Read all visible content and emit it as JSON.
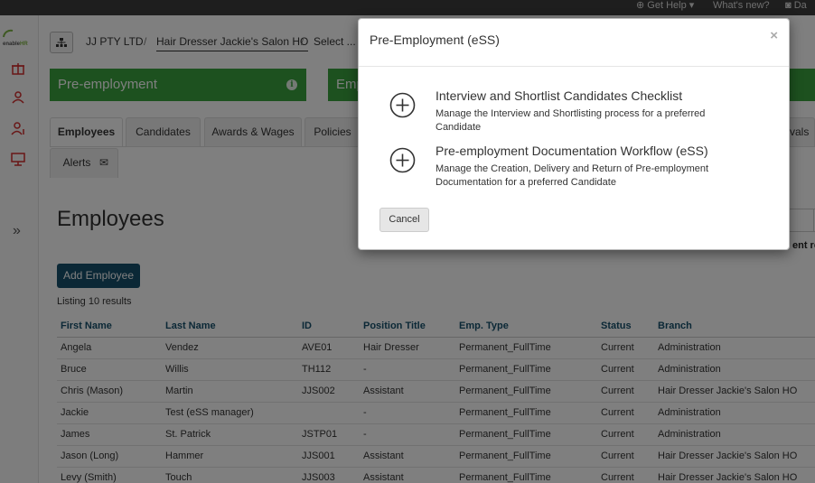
{
  "topbar": {
    "help_label": "Get Help",
    "whats_new_label": "What's new?",
    "account_label": "Da"
  },
  "sidebar": {
    "logo_text_a": "enable",
    "logo_text_b": "HR"
  },
  "breadcrumb": {
    "company": "JJ PTY LTD",
    "location": "Hair Dresser Jackie's Salon HO",
    "select": "Select ..."
  },
  "tiles": [
    {
      "label": "Pre-employment"
    },
    {
      "label": "Emp"
    }
  ],
  "tabs": [
    {
      "label": "Employees"
    },
    {
      "label": "Candidates"
    },
    {
      "label": "Awards & Wages"
    },
    {
      "label": "Policies"
    },
    {
      "label": "vals"
    },
    {
      "label": "Alerts"
    }
  ],
  "page": {
    "title": "Employees",
    "add_button": "Add Employee",
    "listing": "Listing 10 results",
    "right_hint": "ent re",
    "right_dot": "."
  },
  "table": {
    "headers": [
      "First Name",
      "Last Name",
      "ID",
      "Position Title",
      "Emp. Type",
      "Status",
      "Branch"
    ],
    "rows": [
      [
        "Angela",
        "Vendez",
        "AVE01",
        "Hair Dresser",
        "Permanent_FullTime",
        "Current",
        "Administration"
      ],
      [
        "Bruce",
        "Willis",
        "TH112",
        "-",
        "Permanent_FullTime",
        "Current",
        "Administration"
      ],
      [
        "Chris (Mason)",
        "Martin",
        "JJS002",
        "Assistant",
        "Permanent_FullTime",
        "Current",
        "Hair Dresser Jackie's Salon HO"
      ],
      [
        "Jackie",
        "Test (eSS manager)",
        "",
        "-",
        "Permanent_FullTime",
        "Current",
        "Administration"
      ],
      [
        "James",
        "St. Patrick",
        "JSTP01",
        "-",
        "Permanent_FullTime",
        "Current",
        "Administration"
      ],
      [
        "Jason (Long)",
        "Hammer",
        "JJS001",
        "Assistant",
        "Permanent_FullTime",
        "Current",
        "Hair Dresser Jackie's Salon HO"
      ],
      [
        "Levy (Smith)",
        "Touch",
        "JJS003",
        "Assistant",
        "Permanent_FullTime",
        "Current",
        "Hair Dresser Jackie's Salon HO"
      ]
    ]
  },
  "modal": {
    "title": "Pre-Employment (eSS)",
    "close": "×",
    "options": [
      {
        "title": "Interview and Shortlist Candidates Checklist",
        "description": "Manage the Interview and Shortlisting process for a preferred Candidate"
      },
      {
        "title": "Pre-employment Documentation Workflow (eSS)",
        "description": "Manage the Creation, Delivery and Return of Pre-employment Documentation for a preferred Candidate"
      }
    ],
    "cancel_label": "Cancel"
  },
  "colors": {
    "brand_green": "#3aa33e",
    "primary_button": "#17506c",
    "header_link": "#17506c"
  }
}
